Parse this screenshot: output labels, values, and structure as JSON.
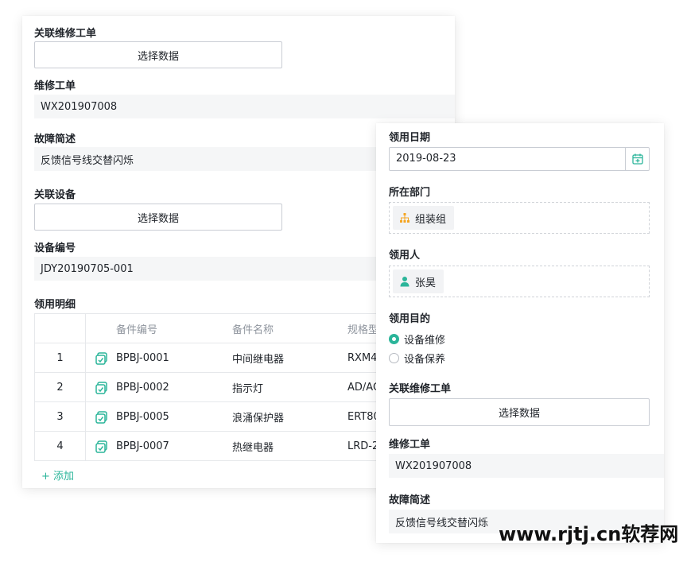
{
  "left_form": {
    "related_order_label": "关联维修工单",
    "related_order_button": "选择数据",
    "repair_order_label": "维修工单",
    "repair_order_value": "WX201907008",
    "fault_label": "故障简述",
    "fault_value": "反馈信号线交替闪烁",
    "related_device_label": "关联设备",
    "related_device_button": "选择数据",
    "device_no_label": "设备编号",
    "device_no_value": "JDY20190705-001",
    "detail_label": "领用明细",
    "table": {
      "headers": [
        "备件编号",
        "备件名称",
        "规格型"
      ],
      "rows": [
        {
          "idx": "1",
          "code": "BPBJ-0001",
          "name": "中间继电器",
          "spec": "RXM4"
        },
        {
          "idx": "2",
          "code": "BPBJ-0002",
          "name": "指示灯",
          "spec": "AD/AC"
        },
        {
          "idx": "3",
          "code": "BPBJ-0005",
          "name": "浪涌保护器",
          "spec": "ERT80"
        },
        {
          "idx": "4",
          "code": "BPBJ-0007",
          "name": "热继电器",
          "spec": "LRD-2"
        }
      ]
    },
    "add_label": "+ 添加"
  },
  "right_form": {
    "date_label": "领用日期",
    "date_value": "2019-08-23",
    "dept_label": "所在部门",
    "dept_value": "组装组",
    "person_label": "领用人",
    "person_value": "张昊",
    "purpose_label": "领用目的",
    "purpose_options": [
      {
        "label": "设备维修",
        "selected": true
      },
      {
        "label": "设备保养",
        "selected": false
      }
    ],
    "related_order_label": "关联维修工单",
    "related_order_button": "选择数据",
    "repair_order_label": "维修工单",
    "repair_order_value": "WX201907008",
    "fault_label": "故障简述",
    "fault_value": "反馈信号线交替闪烁"
  },
  "watermark": "www.rjtj.cn软荐网",
  "colors": {
    "accent": "#2bb59a",
    "dept_icon": "#f5a623"
  }
}
